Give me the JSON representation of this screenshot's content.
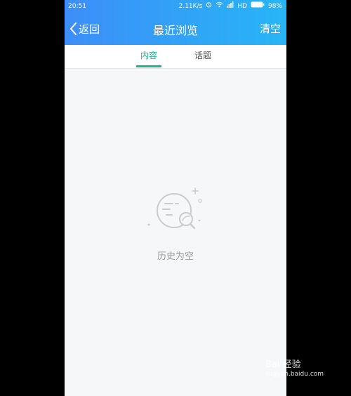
{
  "status_bar": {
    "time": "20:51",
    "speed": "2.11K/s",
    "network": "HD",
    "battery": "98%"
  },
  "header": {
    "back_label": "返回",
    "title": "最近浏览",
    "clear_label": "清空"
  },
  "tabs": [
    {
      "label": "内容",
      "active": true
    },
    {
      "label": "话题",
      "active": false
    }
  ],
  "empty_state": {
    "message": "历史为空",
    "icon": "empty-planet-icon"
  },
  "watermark": {
    "brand": "Bai 经验",
    "url": "jingyan.baidu.com"
  },
  "colors": {
    "header_start": "#3d8ef8",
    "header_end": "#27b5f6",
    "accent": "#19b38f",
    "background": "#f6f7f9"
  }
}
